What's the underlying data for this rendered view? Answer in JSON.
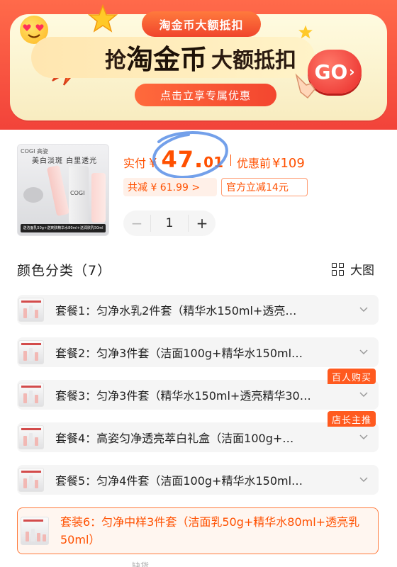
{
  "banner": {
    "tag": "淘金币大额抵扣",
    "headline_pre": "抢",
    "headline_main": "淘金币",
    "headline_post": "大额抵扣",
    "subtitle": "点击立享专属优惠",
    "go_label": "GO",
    "colors": {
      "bg": "#f2433a",
      "card": "#fff3c8",
      "accent": "#ff5000"
    }
  },
  "product": {
    "thumb_brand": "COGI 高姿",
    "thumb_headline": "美白淡斑 白里透光",
    "thumb_caption": "送洁面乳50g+送爽肤精华水80ml+送润肤乳50ml",
    "thumb_logo": "COGI",
    "price_label": "实付",
    "currency": "¥",
    "price_int": "47.",
    "price_dec": "01",
    "orig_label": "优惠前",
    "orig_price": "¥109",
    "discount_chip": "共减 ¥ 61.99 >",
    "official_chip": "官方立减14元",
    "quantity": "1",
    "minus": "−",
    "plus": "+"
  },
  "section": {
    "title": "颜色分类（7）",
    "view_label": "大图"
  },
  "options": [
    {
      "label": "套餐1：匀净水乳2件套（精华水150ml+透亮…",
      "badge": ""
    },
    {
      "label": "套餐2：匀净3件套（洁面100g+精华水150ml…",
      "badge": ""
    },
    {
      "label": "套餐3：匀净3件套（精华水150ml+透亮精华30…",
      "badge": "百人购买"
    },
    {
      "label": "套餐4：高姿匀净透亮萃白礼盒（洁面100g+…",
      "badge": "店长主推"
    },
    {
      "label": "套餐5：匀净4件套（洁面100g+精华水150ml…",
      "badge": ""
    }
  ],
  "selected_option": {
    "label": "套装6：匀净中样3件套（洁面乳50g+精华水80ml+透亮乳50ml）"
  },
  "cut_text": "缺货"
}
